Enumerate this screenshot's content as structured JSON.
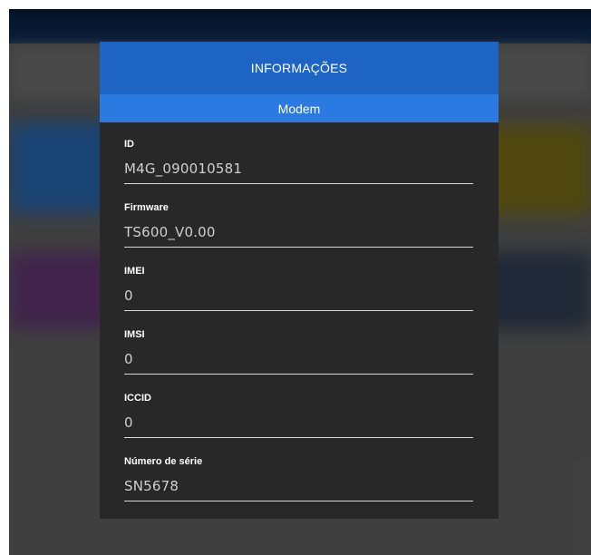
{
  "modal": {
    "title": "INFORMAÇÕES",
    "section": "Modem",
    "fields": [
      {
        "label": "ID",
        "value": "M4G_090010581"
      },
      {
        "label": "Firmware",
        "value": "TS600_V0.00"
      },
      {
        "label": "IMEI",
        "value": "0"
      },
      {
        "label": "IMSI",
        "value": "0"
      },
      {
        "label": "ICCID",
        "value": "0"
      },
      {
        "label": "Número de série",
        "value": "SN5678"
      }
    ]
  },
  "colors": {
    "header": "#1d64c4",
    "subheader": "#2a7ae2",
    "modal_bg": "#282828"
  }
}
